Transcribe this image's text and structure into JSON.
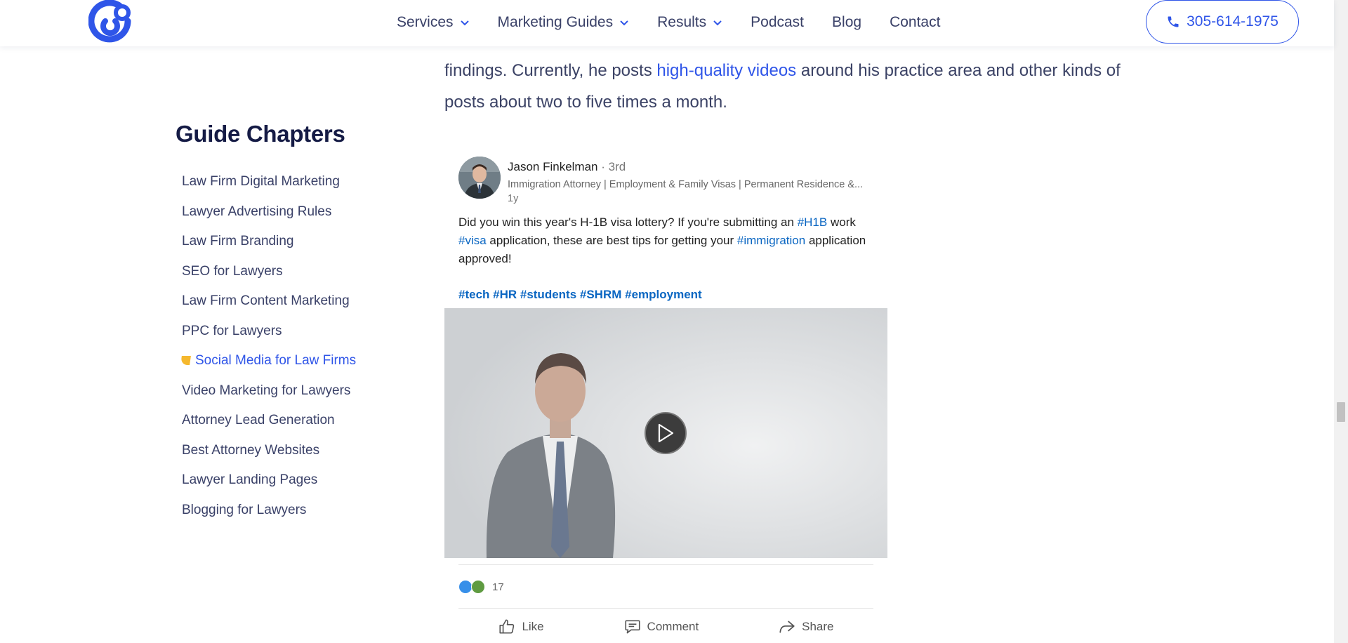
{
  "header": {
    "nav": [
      {
        "label": "Services",
        "has_dropdown": true
      },
      {
        "label": "Marketing Guides",
        "has_dropdown": true
      },
      {
        "label": "Results",
        "has_dropdown": true
      },
      {
        "label": "Podcast",
        "has_dropdown": false
      },
      {
        "label": "Blog",
        "has_dropdown": false
      },
      {
        "label": "Contact",
        "has_dropdown": false
      }
    ],
    "phone": "305-614-1975"
  },
  "article": {
    "line1_pre": "findings. Currently, he posts ",
    "line1_link": "high-quality videos",
    "line1_post": " around his practice area and other kinds of",
    "line2": "posts about two to five times a month."
  },
  "sidebar": {
    "title": "Guide Chapters",
    "chapters": [
      "Law Firm Digital Marketing",
      "Lawyer Advertising Rules",
      "Law Firm Branding",
      "SEO for Lawyers",
      "Law Firm Content Marketing",
      "PPC for Lawyers",
      "Social Media for Law Firms",
      "Video Marketing for Lawyers",
      "Attorney Lead Generation",
      "Best Attorney Websites",
      "Lawyer Landing Pages",
      "Blogging for Lawyers"
    ],
    "active_chapter": "Social Media for Law Firms"
  },
  "post": {
    "author": "Jason Finkelman",
    "degree": "· 3rd",
    "headline": "Immigration Attorney | Employment & Family Visas | Permanent Residence &...",
    "age": "1y",
    "text_1": "Did you win this year's H-1B visa lottery? If you're submitting an ",
    "tag_h1b": "#H1B",
    "text_2": " work ",
    "tag_visa": "#visa",
    "text_3": " application, these are best tips for getting your ",
    "tag_immigration": "#immigration",
    "text_4": " application approved!",
    "hashtags": "#tech #HR #students #SHRM #employment",
    "reaction_count": "17",
    "actions": {
      "like": "Like",
      "comment": "Comment",
      "share": "Share"
    }
  },
  "colors": {
    "accent": "#2f55e8",
    "linkedin_blue": "#0a66c2",
    "marker": "#f5b82e",
    "heading": "#151b45"
  }
}
